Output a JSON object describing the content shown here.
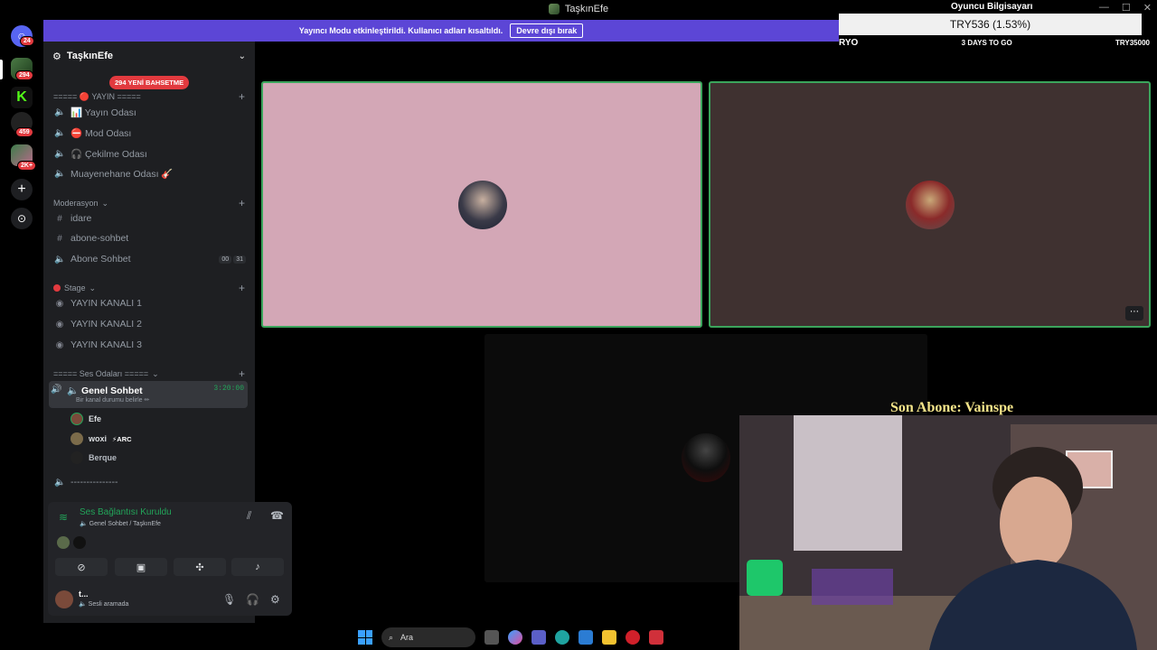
{
  "window": {
    "title": "TaşkınEfe",
    "controls": [
      "—",
      "☐",
      "✕"
    ]
  },
  "notice": {
    "text": "Yayıncı Modu etkinleştirildi. Kullanıcı adları kısaltıldı.",
    "button": "Devre dışı bırak"
  },
  "rail": {
    "badges": [
      "24",
      "294",
      "459",
      "2K+"
    ]
  },
  "sidebar": {
    "guild_name": "TaşkınEfe",
    "mention_pill": "294 YENİ BAHSETME",
    "categories": {
      "yayin": "===== 🔴 YAYIN =====",
      "moderasyon": "Moderasyon",
      "stage": "Stage",
      "ses": "===== Ses Odaları ====="
    },
    "channels": {
      "yayin_odasi": "📊 Yayın Odası",
      "mod_odasi": "⛔ Mod Odası",
      "cekilme_odasi": "🎧 Çekilme Odası",
      "muayenehane": "Muayenehane Odası 🎸",
      "idare": "idare",
      "abone_sohbet_text": "abone-sohbet",
      "abone_sohbet_voice": "Abone Sohbet",
      "kanal1": "YAYIN KANALI 1",
      "kanal2": "YAYIN KANALI 2",
      "kanal3": "YAYIN KANALI 3",
      "genel": "🔈 Genel Sohbet",
      "genel_status": "Bir kanal durumu belirle ✏",
      "genel_time": "3:20:00",
      "dashes": "---------------"
    },
    "abone_counter": [
      "00",
      "31"
    ],
    "members": [
      {
        "name": "Efe",
        "tag": ""
      },
      {
        "name": "woxi",
        "tag": "⚡ARC"
      },
      {
        "name": "Berque",
        "tag": ""
      }
    ]
  },
  "voice_panel": {
    "status": "Ses Bağlantısı Kuruldu",
    "channel": "🔈 Genel Sohbet / TaşkınEfe",
    "user_name": "t...",
    "user_status": "🔈 Sesli aramada"
  },
  "overlay": {
    "player": "Oyuncu Bilgisayarı",
    "donation": "TRY536 (1.53%)",
    "goal_left": "RYO",
    "goal_mid": "3 DAYS TO GO",
    "goal_right": "TRY35000",
    "last_sub": "Son Abone: Vainspe"
  },
  "taskbar": {
    "search_placeholder": "Ara"
  },
  "colors": {
    "accent": "#5c46d6",
    "speaking_border": "#3ba55c",
    "badge_red": "#e23a3f",
    "tile1_bg": "#d3a7b6",
    "tile2_bg": "#3f3130"
  }
}
